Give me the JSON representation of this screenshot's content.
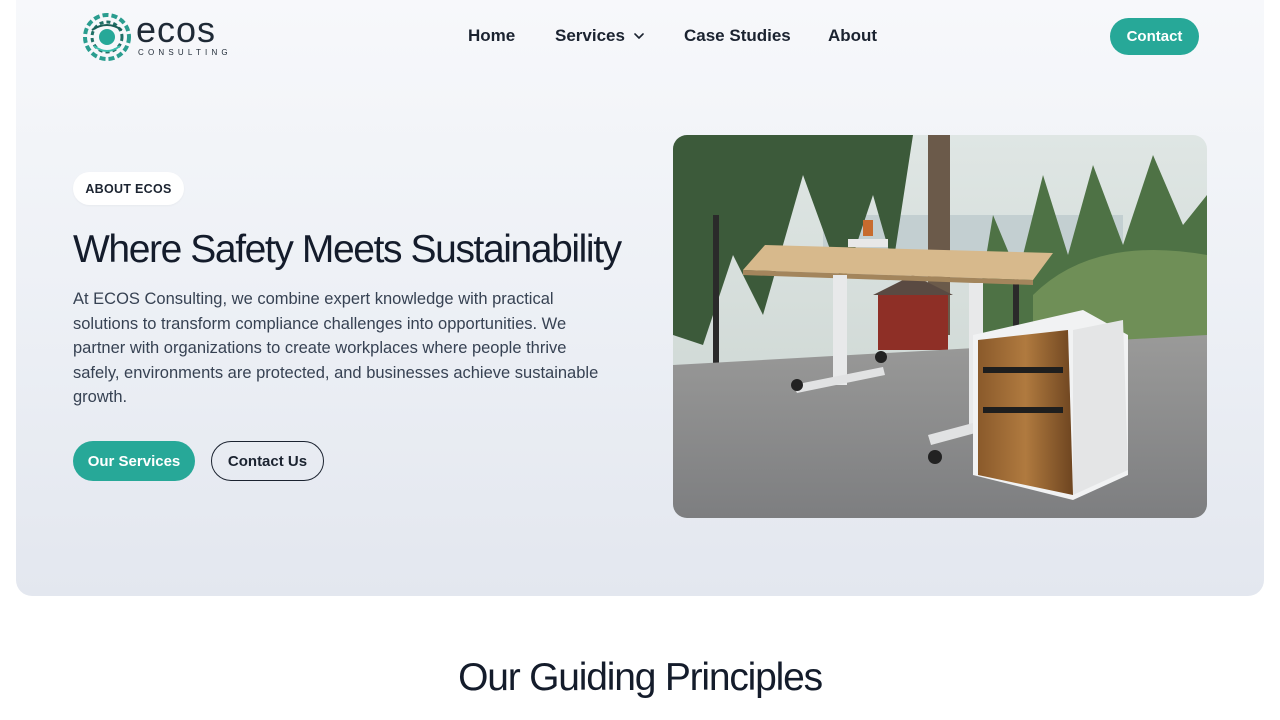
{
  "brand": {
    "name": "ecos",
    "tagline": "CONSULTING",
    "accent_color": "#27a898",
    "dark_color": "#141c2b"
  },
  "nav": {
    "items": [
      {
        "label": "Home"
      },
      {
        "label": "Services",
        "icon": "chevron-down-icon"
      },
      {
        "label": "Case Studies"
      },
      {
        "label": "About"
      }
    ],
    "cta_label": "Contact"
  },
  "hero": {
    "badge": "ABOUT ECOS",
    "title": "Where Safety Meets Sustainability",
    "description": "At ECOS Consulting, we combine expert knowledge with practical solutions to transform compliance challenges into opportunities. We partner with organizations to create workplaces where people thrive safely, environments are protected, and businesses achieve sustainable growth.",
    "primary_button": "Our Services",
    "secondary_button": "Contact Us",
    "image_subject": "standing desk and wood drawer cabinet on outdoor deck"
  },
  "section": {
    "title": "Our Guiding Principles"
  }
}
